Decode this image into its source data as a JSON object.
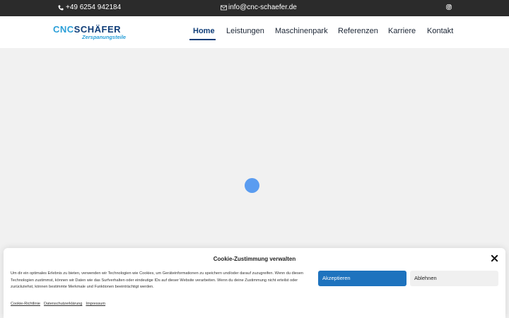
{
  "topbar": {
    "phone": "+49 6254 942184",
    "email": "info@cnc-schaefer.de",
    "phone_icon": "phone-icon",
    "email_icon": "envelope-icon",
    "social_icon": "instagram-icon"
  },
  "logo": {
    "line1_cnc": "CNC",
    "line1_name": "SCHÄFER",
    "line2": "Zerspanungsteile"
  },
  "nav": {
    "items": [
      {
        "label": "Home",
        "active": true
      },
      {
        "label": "Leistungen"
      },
      {
        "label": "Maschinenpark"
      },
      {
        "label": "Referenzen"
      },
      {
        "label": "Karriere"
      },
      {
        "label": "Kontakt"
      }
    ]
  },
  "colors": {
    "topbar": "#2b2b2b",
    "brand_dark": "#0f3d78",
    "brand_light": "#2a9fd8",
    "accept_button": "#1e73be",
    "loader": "#5a9cf0"
  },
  "cookie": {
    "title": "Cookie-Zustimmung verwalten",
    "text": "Um dir ein optimales Erlebnis zu bieten, verwenden wir Technologien wie Cookies, um Geräteinformationen zu speichern und/oder darauf zuzugreifen. Wenn du diesen Technologien zustimmst, können wir Daten wie das Surfverhalten oder eindeutige IDs auf dieser Website verarbeiten. Wenn du deine Zustimmung nicht erteilst oder zurückziehst, können bestimmte Merkmale und Funktionen beeinträchtigt werden.",
    "accept_label": "Akzeptieren",
    "deny_label": "Ablehnen",
    "links": [
      "Cookie-Richtlinie",
      "Datenschutzerklärung",
      "Impressum"
    ],
    "close_icon": "close-icon"
  }
}
